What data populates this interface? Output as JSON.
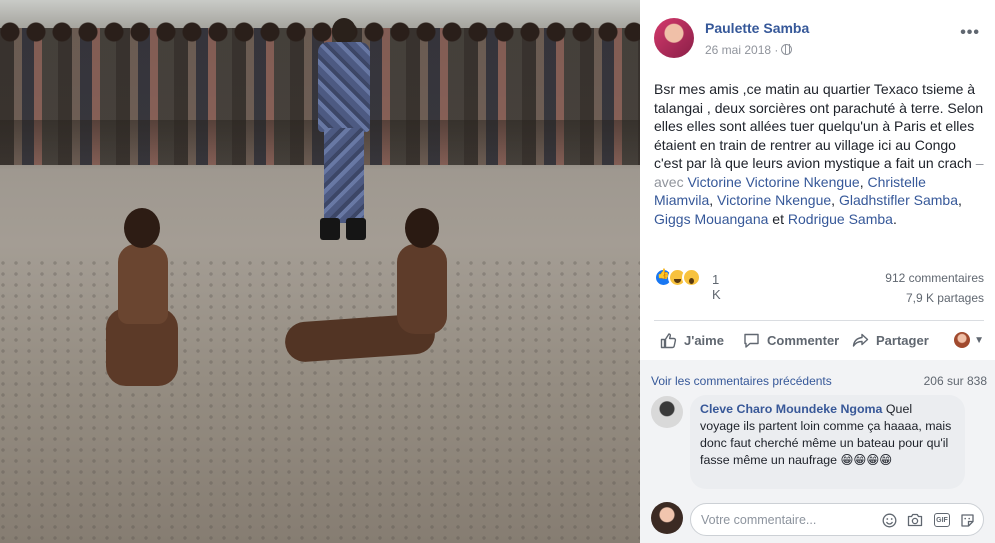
{
  "post": {
    "author": "Paulette Samba",
    "date": "26 mai 2018 ·",
    "more_label": "•••",
    "text_main": "Bsr mes amis ,ce matin au quartier Texaco tsieme à talangai , deux sorcières ont parachuté à terre. Selon elles elles sont allées tuer quelqu'un à Paris et elles étaient en train de rentrer au village ici au Congo c'est par là que leurs avion mystique a fait un crach",
    "with_sep": " – avec ",
    "tags": [
      "Victorine Victorine Nkengue",
      "Christelle Miamvila",
      "Victorine Nkengue",
      "Gladhstifler Samba",
      "Giggs Mouangana",
      "Rodrigue Samba"
    ],
    "tag_sep": ", ",
    "tag_and": " et ",
    "tag_end": "."
  },
  "stats": {
    "reaction_icons": [
      "like-reaction",
      "haha-reaction",
      "wow-reaction"
    ],
    "reaction_count": "1 K",
    "comments": "912 commentaires",
    "shares": "7,9 K partages"
  },
  "actions": {
    "like": "J'aime",
    "comment": "Commenter",
    "share": "Partager"
  },
  "comments": {
    "prev_link": "Voir les commentaires précédents",
    "count": "206 sur 838",
    "items": [
      {
        "name": "Cleve Charo Moundeke Ngoma",
        "text": "Quel voyage ils partent loin comme ça haaaa, mais donc faut cherché même un bateau pour qu'il fasse même un naufrage 😁😁😁😁"
      }
    ],
    "reply_placeholder": "Votre commentaire...",
    "gif_label": "GIF"
  },
  "colors": {
    "link": "#365899",
    "muted": "#606770",
    "like_blue": "#1877f2",
    "reaction_yellow": "#f7c23e"
  }
}
